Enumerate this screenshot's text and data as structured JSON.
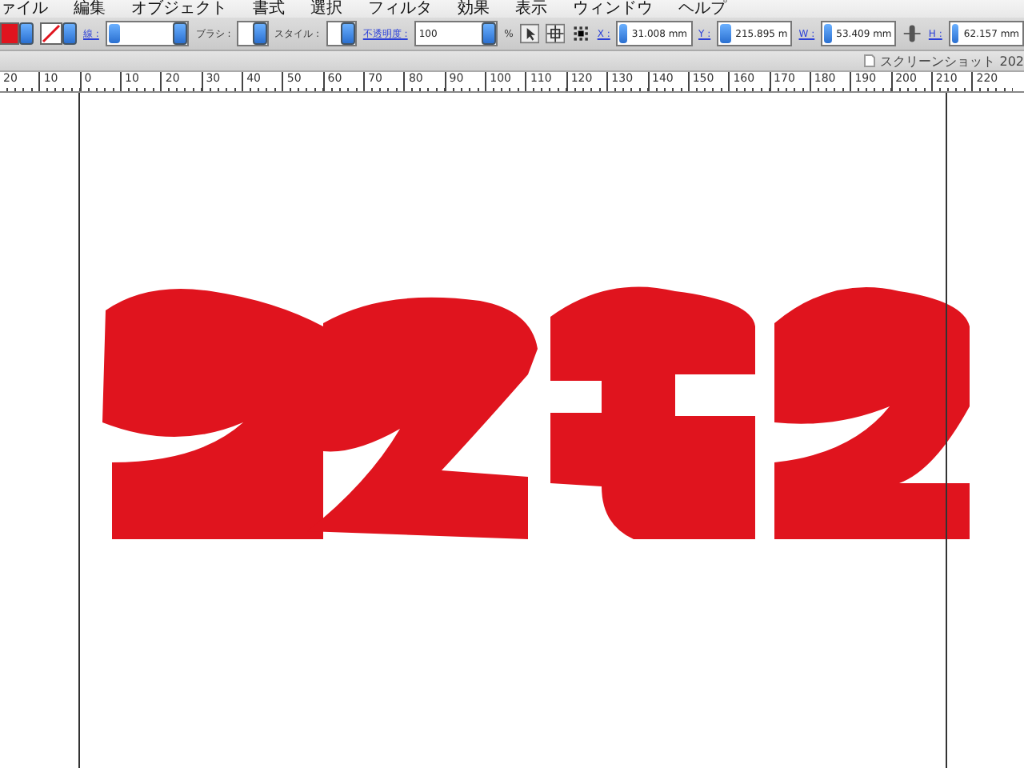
{
  "menu_bar": {
    "items": [
      "ァイル",
      "編集",
      "オブジェクト",
      "書式",
      "選択",
      "フィルタ",
      "効果",
      "表示",
      "ウィンドウ",
      "ヘルプ"
    ]
  },
  "control_bar": [
    {
      "kind": "fill",
      "color": "#e0141e"
    },
    {
      "kind": "stroke"
    },
    {
      "kind": "link",
      "text": "線 :"
    },
    {
      "kind": "spinfield"
    },
    {
      "kind": "label",
      "text": "ブラシ :"
    },
    {
      "kind": "dropdown"
    },
    {
      "kind": "label",
      "text": "スタイル :"
    },
    {
      "kind": "dropdown"
    },
    {
      "kind": "link",
      "text": "不透明度 :"
    },
    {
      "kind": "combo",
      "value": "100"
    },
    {
      "kind": "label",
      "text": "%"
    },
    {
      "kind": "pointer"
    },
    {
      "kind": "target"
    },
    {
      "kind": "grid"
    },
    {
      "kind": "link",
      "text": "X :"
    },
    {
      "kind": "coord",
      "value": "31.008 mm"
    },
    {
      "kind": "link",
      "text": "Y :"
    },
    {
      "kind": "coord",
      "value": "215.895 m"
    },
    {
      "kind": "link",
      "text": "W :"
    },
    {
      "kind": "coord",
      "value": "53.409 mm"
    },
    {
      "kind": "chain"
    },
    {
      "kind": "link",
      "text": "H :"
    },
    {
      "kind": "coord",
      "value": "62.157 mm"
    }
  ],
  "document_tab": {
    "title": "スクリーンショット 202"
  },
  "ruler": {
    "labels": [
      "20",
      "10",
      "0",
      "10",
      "20",
      "30",
      "40",
      "50",
      "60",
      "70",
      "80",
      "90",
      "100",
      "110",
      "120",
      "130",
      "140",
      "150",
      "160",
      "170",
      "180",
      "190",
      "200",
      "210",
      "220"
    ]
  }
}
